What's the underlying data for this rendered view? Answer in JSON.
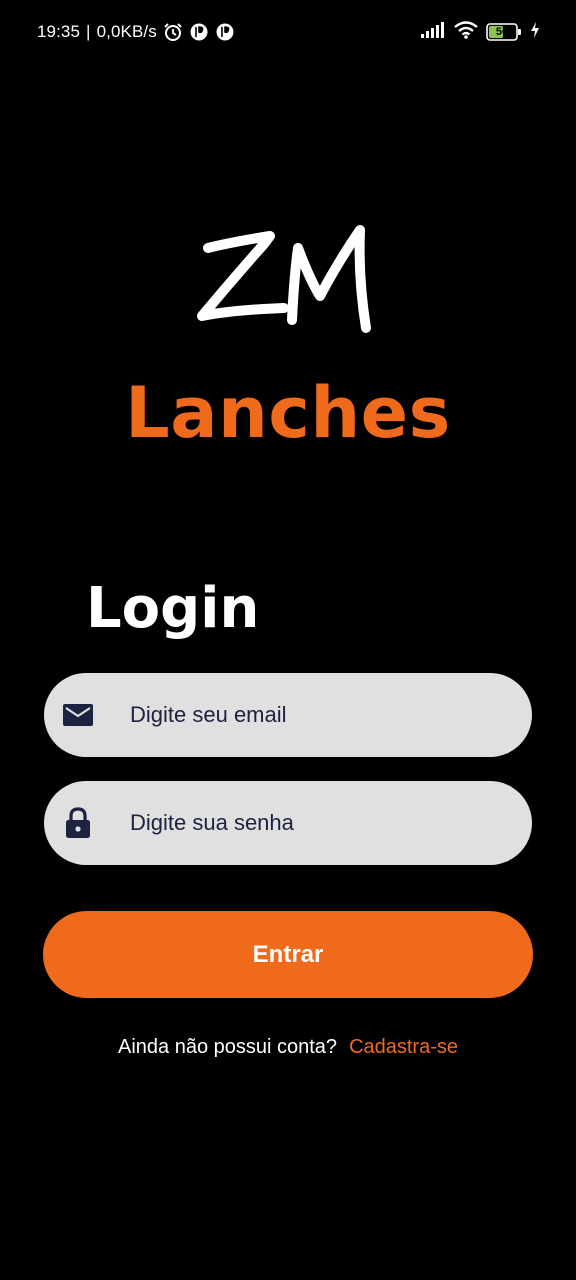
{
  "status_bar": {
    "time": "19:35",
    "separator": "|",
    "network_speed": "0,0KB/s",
    "left_icons": [
      "alarm-icon",
      "app-notification-icon",
      "app-notification-icon"
    ],
    "right_icons": [
      "signal-icon",
      "wifi-icon",
      "battery-icon",
      "charging-icon"
    ],
    "battery_level": "50"
  },
  "logo": {
    "monogram": "ZM",
    "brand_name": "Lanches",
    "brand_color": "#f06a1c"
  },
  "login": {
    "title": "Login",
    "email_field": {
      "icon": "email-icon",
      "value": "",
      "placeholder": "Digite seu email"
    },
    "password_field": {
      "icon": "lock-icon",
      "value": "",
      "placeholder": "Digite sua senha"
    },
    "submit_label": "Entrar",
    "signup_prompt": "Ainda não possui conta?",
    "signup_link": "Cadastra-se"
  },
  "colors": {
    "background": "#000000",
    "accent": "#f06a1c",
    "field_background": "#e0e0e0",
    "field_text": "#1c2240"
  }
}
